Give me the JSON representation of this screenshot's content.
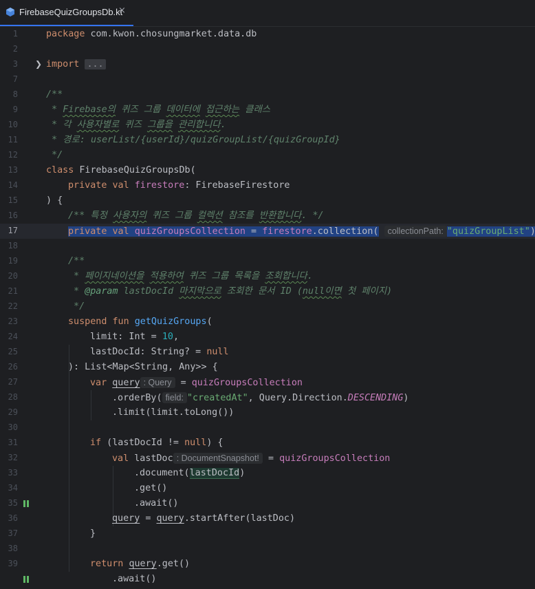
{
  "tab": {
    "label": "FirebaseQuizGroupsDb.kt",
    "close": "×"
  },
  "lines": [
    {
      "n": "1"
    },
    {
      "n": "2"
    },
    {
      "n": "3"
    },
    {
      "n": "7"
    },
    {
      "n": "8"
    },
    {
      "n": "9"
    },
    {
      "n": "10"
    },
    {
      "n": "11"
    },
    {
      "n": "12"
    },
    {
      "n": "13"
    },
    {
      "n": "14"
    },
    {
      "n": "15"
    },
    {
      "n": "16"
    },
    {
      "n": "17"
    },
    {
      "n": "18"
    },
    {
      "n": "19"
    },
    {
      "n": "20"
    },
    {
      "n": "21"
    },
    {
      "n": "22"
    },
    {
      "n": "23"
    },
    {
      "n": "24"
    },
    {
      "n": "25"
    },
    {
      "n": "26"
    },
    {
      "n": "27"
    },
    {
      "n": "28"
    },
    {
      "n": "29"
    },
    {
      "n": "30"
    },
    {
      "n": "31"
    },
    {
      "n": "32"
    },
    {
      "n": "33"
    },
    {
      "n": "34"
    },
    {
      "n": "35"
    },
    {
      "n": "36"
    },
    {
      "n": "37"
    },
    {
      "n": "38"
    },
    {
      "n": "39"
    }
  ],
  "code": {
    "l1_kw": "package",
    "l1_rest": " com.kwon.chosungmarket.data.db",
    "l3_kw": "import",
    "l3_dots": "...",
    "l7": "/**",
    "l8a": " * ",
    "l8b": "Firebase의",
    "l8c": " 퀴즈 그룹 ",
    "l8d": "데이터에",
    "l8e": " ",
    "l8f": "접근하는",
    "l8g": " 클래스",
    "l9a": " * 각 ",
    "l9b": "사용자별로",
    "l9c": " 퀴즈 ",
    "l9d": "그룹을",
    "l9e": " ",
    "l9f": "관리합니다",
    "l9g": ".",
    "l10": " * 경로: userList/{userId}/quizGroupList/{quizGroupId}",
    "l11": " */",
    "l12_kw": "class",
    "l12_rest": " FirebaseQuizGroupsDb(",
    "l13_kw": "private val",
    "l13_prop": "firestore",
    "l13_rest": ": FirebaseFirestore",
    "l14": ") {",
    "l15a": "/** 특정 ",
    "l15b": "사용자의",
    "l15c": " 퀴즈 그룹 ",
    "l15d": "컬렉션",
    "l15e": " 참조를 ",
    "l15f": "반환합니다",
    "l15g": ". */",
    "l16_kw": "private val",
    "l16_prop": "quizGroupsCollection",
    "l16_eq": " = ",
    "l16_prop2": "firestore",
    "l16_call": ".collection(",
    "l16_hint": "collectionPath:",
    "l16_str": "\"quizGroupList\"",
    "l16_end": ")",
    "l18": "/**",
    "l19a": " * ",
    "l19b": "페이지네이션을",
    "l19c": " ",
    "l19d": "적용하여",
    "l19e": " 퀴즈 그룹 목록을 ",
    "l19f": "조회합니다",
    "l19g": ".",
    "l20a": " * ",
    "l20tag": "@param",
    "l20b": " lastDocId ",
    "l20c": "마지막으로",
    "l20d": " 조회한 문서 ID (",
    "l20e": "null이면",
    "l20f": " 첫 페이지)",
    "l21": " */",
    "l22_kw": "suspend fun",
    "l22_fn": "getQuizGroups",
    "l22_rest": "(",
    "l23a": "limit: Int = ",
    "l23num": "10",
    "l23b": ",",
    "l24a": "lastDocId: String? = ",
    "l24kw": "null",
    "l25": "): List<Map<String, Any>> {",
    "l26_kw": "var",
    "l26_var": "query",
    "l26_hint": ": Query",
    "l26_eq": " = ",
    "l26_prop": "quizGroupsCollection",
    "l27a": ".orderBy(",
    "l27_hint": "field:",
    "l27_str": "\"createdAt\"",
    "l27b": ", Query.Direction.",
    "l27_en": "DESCENDING",
    "l27c": ")",
    "l28": ".limit(limit.toLong())",
    "l30a": "if",
    "l30b": " (lastDocId != ",
    "l30kw": "null",
    "l30c": ") {",
    "l31_kw": "val",
    "l31_var": " lastDoc",
    "l31_hint": ": DocumentSnapshot!",
    "l31_eq": " = ",
    "l31_prop": "quizGroupsCollection",
    "l32a": ".document(",
    "l32ref": "lastDocId",
    "l32b": ")",
    "l33": ".get()",
    "l34": ".await()",
    "l35_var": "query",
    "l35_eq": " = ",
    "l35_var2": "query",
    "l35_rest": ".startAfter(lastDoc)",
    "l36": "}",
    "l38_kw": "return",
    "l38_var": "query",
    "l38_rest": ".get()",
    "l39": ".await()"
  }
}
